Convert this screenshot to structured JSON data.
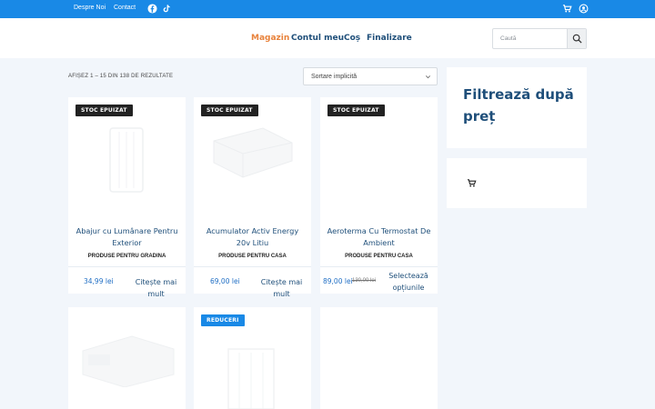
{
  "topbar": {
    "links": [
      "Despre Noi",
      "Contact"
    ],
    "icons": [
      "facebook-icon",
      "tiktok-icon",
      "cart-icon",
      "user-icon"
    ]
  },
  "nav": {
    "items": [
      {
        "label": "Magazin",
        "active": true
      },
      {
        "label": "Contul meu",
        "active": false
      },
      {
        "label": "Coș",
        "active": false
      },
      {
        "label": "Finalizare",
        "active": false
      }
    ]
  },
  "search": {
    "placeholder": "Caută"
  },
  "shop": {
    "results": "AFIȘEZ 1 – 15 DIN 138 DE REZULTATE",
    "sort": "Sortare implicită"
  },
  "products": [
    {
      "badge": "STOC EPUIZAT",
      "title": "Abajur cu Lumânare Pentru Exterior",
      "category": "PRODUSE PENTRU GRADINA",
      "price": "34,99 lei",
      "old_price": "",
      "action": "Citește mai mult"
    },
    {
      "badge": "STOC EPUIZAT",
      "title": "Acumulator Activ Energy 20v Litiu",
      "category": "PRODUSE PENTRU CASA",
      "price": "69,00 lei",
      "old_price": "",
      "action": "Citește mai mult"
    },
    {
      "badge": "STOC EPUIZAT",
      "title": "Aeroterma Cu Termostat De Ambient",
      "category": "PRODUSE PENTRU CASA",
      "price": "89,00 lei",
      "old_price": "130,00 lei",
      "action": "Selectează opțiunile"
    },
    {
      "badge": "",
      "title": "",
      "category": "",
      "price": "",
      "old_price": "",
      "action": ""
    },
    {
      "badge": "REDUCERI",
      "title": "",
      "category": "",
      "price": "",
      "old_price": "",
      "action": ""
    },
    {
      "badge": "",
      "title": "",
      "category": "",
      "price": "",
      "old_price": "",
      "action": ""
    }
  ],
  "sidebar": {
    "filter_title": "Filtrează după preț",
    "cart_icon": "cart-icon"
  },
  "colors": {
    "accent": "#1989e6",
    "active_nav": "#e8823b",
    "title": "#1f4f7a"
  }
}
